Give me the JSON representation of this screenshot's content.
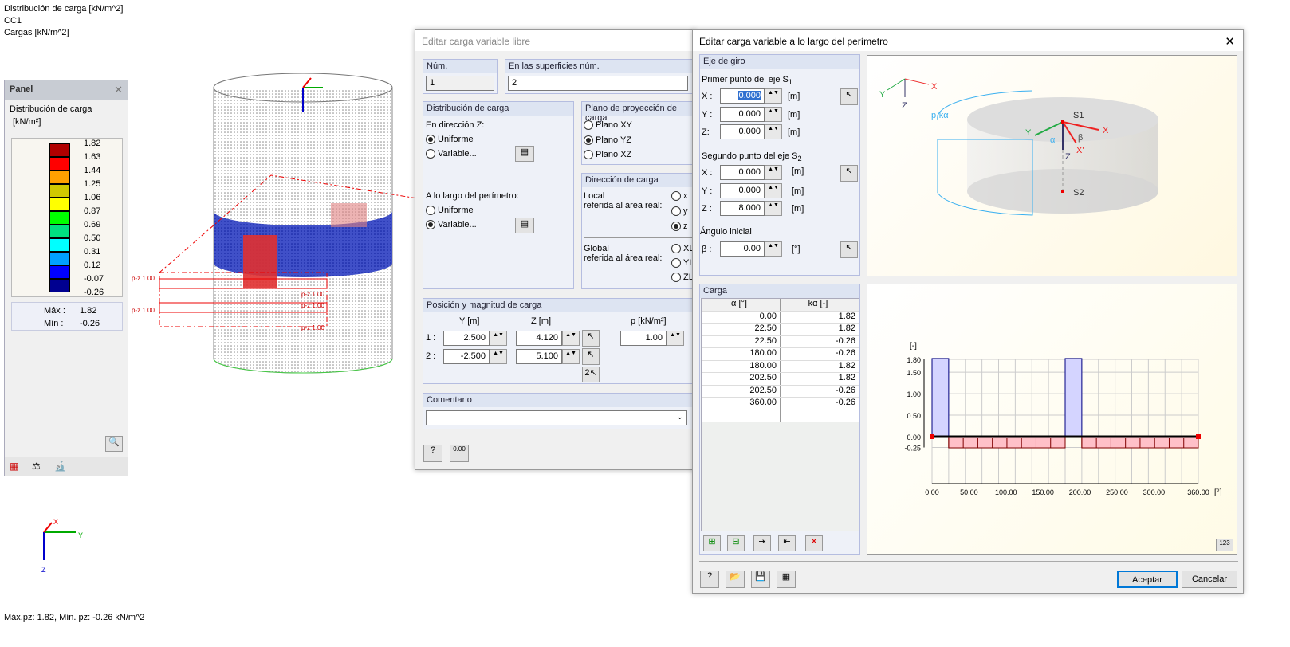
{
  "viewport": {
    "info_lines": [
      "Distribución de carga [kN/m^2]",
      "CC1",
      "Cargas [kN/m^2]"
    ],
    "status": "Máx.pz: 1.82, Mín. pz: -0.26 kN/m^2",
    "load_labels": [
      "p-z 1.00",
      "p-z 1.00",
      "p-z 1.00",
      "p-z 1.00",
      "p-z 1.00"
    ],
    "axes": {
      "x": "X",
      "y": "Y",
      "z": "Z"
    }
  },
  "panel": {
    "title": "Panel",
    "heading": "Distribución de carga",
    "unit": "[kN/m²]",
    "legend_values": [
      "1.82",
      "1.63",
      "1.44",
      "1.25",
      "1.06",
      "0.87",
      "0.69",
      "0.50",
      "0.31",
      "0.12",
      "-0.07",
      "-0.26"
    ],
    "legend_colors": [
      "#b00000",
      "#ff0000",
      "#ffa000",
      "#d0c800",
      "#ffff00",
      "#00ff00",
      "#00e080",
      "#00ffff",
      "#00a0ff",
      "#0000ff",
      "#000090"
    ],
    "max_label": "Máx  :",
    "max_value": "1.82",
    "min_label": "Mín  :",
    "min_value": "-0.26"
  },
  "dialog1": {
    "title": "Editar carga variable libre",
    "num_label": "Núm.",
    "num_value": "1",
    "surfaces_label": "En las superficies núm.",
    "surfaces_value": "2",
    "dist_title": "Distribución de carga",
    "dir_z": "En dirección Z:",
    "uniform": "Uniforme",
    "variable": "Variable...",
    "perimeter": "A lo largo del perímetro:",
    "proj_title": "Plano de proyección de carga",
    "plane_xy": "Plano XY",
    "plane_yz": "Plano YZ",
    "plane_xz": "Plano XZ",
    "dir_title": "Dirección de carga",
    "local": "Local",
    "local2": "referida al área real:",
    "global": "Global",
    "global2": "referida al área real:",
    "opts_local": [
      "x",
      "y",
      "z"
    ],
    "opts_global": [
      "XL",
      "YL",
      "ZL"
    ],
    "pos_title": "Posición y magnitud de carga",
    "col_y": "Y  [m]",
    "col_z": "Z  [m]",
    "col_p": "p  [kN/m²]",
    "row1": "1 :",
    "row2": "2 :",
    "y1": "2.500",
    "z1": "4.120",
    "y2": "-2.500",
    "z2": "5.100",
    "p1": "1.00",
    "comment_title": "Comentario",
    "comment_value": ""
  },
  "dialog2": {
    "title": "Editar carga variable a lo largo del perímetro",
    "axis_title": "Eje de giro",
    "first": "Primer punto del eje S",
    "first_sub": "1",
    "second": "Segundo punto del eje S",
    "second_sub": "2",
    "x_label": "X :",
    "y_label": "Y :",
    "z_label": "Z:",
    "z2_label": "Z :",
    "unit_m": "[m]",
    "s1": {
      "x": "0.000",
      "y": "0.000",
      "z": "0.000"
    },
    "s2": {
      "x": "0.000",
      "y": "0.000",
      "z": "8.000"
    },
    "angle_title": "Ángulo inicial",
    "beta_label": "β :",
    "beta": "0.00",
    "unit_deg": "[°]",
    "load_title": "Carga",
    "col_alpha": "α [°]",
    "col_k": "kα [-]",
    "rows": [
      [
        "0.00",
        "1.82"
      ],
      [
        "22.50",
        "1.82"
      ],
      [
        "22.50",
        "-0.26"
      ],
      [
        "180.00",
        "-0.26"
      ],
      [
        "180.00",
        "1.82"
      ],
      [
        "202.50",
        "1.82"
      ],
      [
        "202.50",
        "-0.26"
      ],
      [
        "360.00",
        "-0.26"
      ]
    ],
    "diagram": {
      "pk": "p·kα",
      "s1": "S1",
      "s2": "S2",
      "x": "X",
      "y": "Y",
      "z": "Z",
      "xp": "X'",
      "alpha": "α",
      "beta": "β"
    },
    "ok": "Aceptar",
    "cancel": "Cancelar"
  },
  "chart_data": {
    "type": "area",
    "ylabel": "[-]",
    "xlabel": "[°]",
    "xlim": [
      0,
      360
    ],
    "ylim": [
      -0.25,
      1.8
    ],
    "x_ticks": [
      "0.00",
      "50.00",
      "100.00",
      "150.00",
      "200.00",
      "250.00",
      "300.00",
      "360.00"
    ],
    "x_tick_values": [
      0,
      50,
      100,
      150,
      200,
      250,
      300,
      360
    ],
    "y_ticks": [
      "1.80",
      "1.50",
      "1.00",
      "0.50",
      "0.00",
      "-0.25"
    ],
    "y_tick_values": [
      1.8,
      1.5,
      1.0,
      0.5,
      0,
      -0.25
    ],
    "x": [
      0,
      22.5,
      22.5,
      180,
      180,
      202.5,
      202.5,
      360
    ],
    "y": [
      1.82,
      1.82,
      -0.26,
      -0.26,
      1.82,
      1.82,
      -0.26,
      -0.26
    ],
    "colors": {
      "positive": "#d4d4ff",
      "positive_line": "#000080",
      "negative": "#ffc0c8",
      "negative_line": "#800000"
    }
  }
}
